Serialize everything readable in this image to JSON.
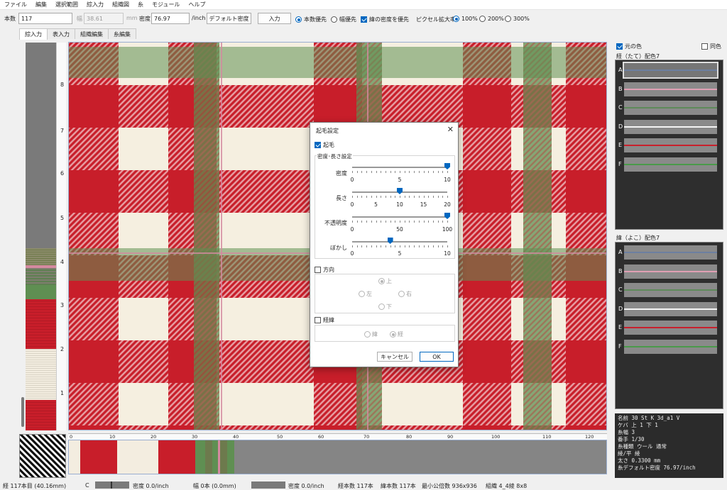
{
  "menu": [
    "ファイル",
    "編集",
    "選択範囲",
    "綜入力",
    "組織図",
    "糸",
    "モジュール",
    "ヘルプ"
  ],
  "toolbar": {
    "count_label": "本数",
    "count_value": "117",
    "width_label": "幅",
    "width_value": "38.61",
    "width_unit": "mm",
    "density_label": "密度",
    "density_value": "76.97",
    "density_unit": "/inch",
    "default_density_btn": "デフォルト密度",
    "input_btn": "入力",
    "prio_count": "本数優先",
    "prio_width": "幅優先",
    "weft_density_prio": "緯の密度を優先",
    "zoom_label": "ピクセル拡大率",
    "zoom_options": [
      "100%",
      "200%",
      "300%"
    ]
  },
  "tabs": [
    "綜入力",
    "表入力",
    "組織編集",
    "糸編集"
  ],
  "ruler_v_labels": [
    "8",
    "7",
    "6",
    "5",
    "4",
    "3",
    "2",
    "1"
  ],
  "ruler_h_labels": [
    "0",
    "10",
    "20",
    "30",
    "40",
    "50",
    "60",
    "70",
    "80",
    "90",
    "100",
    "110",
    "120"
  ],
  "right_panel": {
    "original_color": "元の色",
    "same_color": "同色",
    "warp_title": "経（たて）配色7",
    "weft_title": "緯（よこ）配色7",
    "warp_yarns": [
      {
        "label": "A",
        "color": "#6c7fa0"
      },
      {
        "label": "B",
        "color": "#e0a0b4"
      },
      {
        "label": "C",
        "color": "#5e8a5a"
      },
      {
        "label": "D",
        "color": "#f4f4f4"
      },
      {
        "label": "E",
        "color": "#c8202c"
      },
      {
        "label": "F",
        "color": "#4a9a4a"
      }
    ],
    "weft_yarns": [
      {
        "label": "A",
        "color": "#6c7fa0"
      },
      {
        "label": "B",
        "color": "#e0a0b4"
      },
      {
        "label": "C",
        "color": "#5e8a5a"
      },
      {
        "label": "D",
        "color": "#f4f4f4"
      },
      {
        "label": "E",
        "color": "#c8202c"
      },
      {
        "label": "F",
        "color": "#4a9a4a"
      }
    ],
    "info_lines": [
      "名前  30 St K 3d_a1 V",
      "ケバ  上 1 下 1",
      "糸幅  3",
      "番手  1/30",
      "糸種類  ウール  通常",
      "綾/平  綾",
      "太さ  0.3300 mm",
      "糸デフォルト密度  76.97/inch"
    ]
  },
  "dialog": {
    "title": "起毛設定",
    "close": "✕",
    "nap_label": "起毛",
    "density_length_group": "密度･長さ設定",
    "sliders": [
      {
        "label": "密度",
        "ticks": [
          "0",
          "5",
          "10"
        ],
        "value": 10,
        "min": 0,
        "max": 10
      },
      {
        "label": "長さ",
        "ticks": [
          "0",
          "5",
          "10",
          "15",
          "20"
        ],
        "value": 10,
        "min": 0,
        "max": 20
      },
      {
        "label": "不透明度",
        "ticks": [
          "0",
          "50",
          "100"
        ],
        "value": 100,
        "min": 0,
        "max": 100
      },
      {
        "label": "ぼかし",
        "ticks": [
          "0",
          "5",
          "10"
        ],
        "value": 4,
        "min": 0,
        "max": 10
      }
    ],
    "direction_label": "方向",
    "dir_up": "上",
    "dir_left": "左",
    "dir_right": "右",
    "dir_down": "下",
    "warpweft_label": "経緯",
    "opt_weft": "緯",
    "opt_warp": "経",
    "cancel": "キャンセル",
    "ok": "OK"
  },
  "status": {
    "warp_info": "経 117本目 (40.16mm)",
    "c_label": "C",
    "density1": "密度 0.0/inch",
    "width_info": "幅 0本 (0.0mm)",
    "density2": "密度 0.0/inch",
    "warp_count": "経本数 117本",
    "weft_count": "緯本数 117本",
    "lcm": "最小公倍数 936x936",
    "weave": "組織 4_4綾 8x8"
  },
  "colors": {
    "red": "#c81e2a",
    "cream": "#f5efe0",
    "green": "#5f8f52",
    "accent": "#0067c0"
  }
}
